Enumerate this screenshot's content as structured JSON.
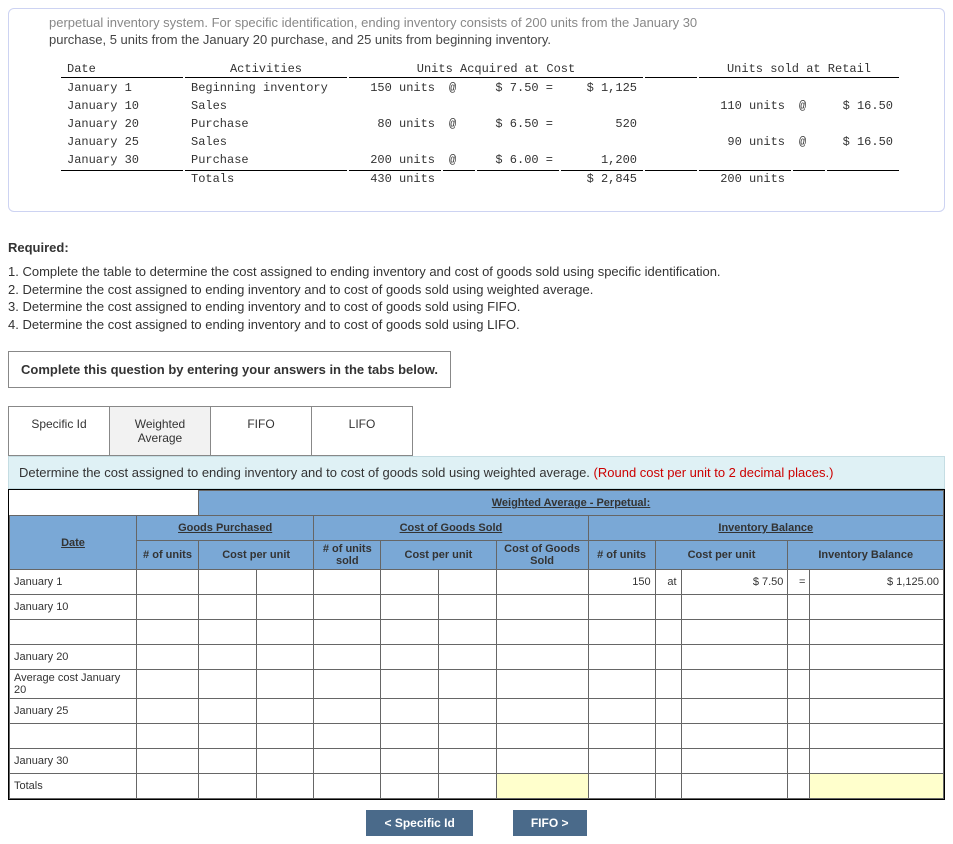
{
  "intro_top": "perpetual inventory system. For specific identification, ending inventory consists of 200 units from the January 30",
  "intro_bot": "purchase, 5 units from the January 20 purchase, and 25 units from beginning inventory.",
  "inv_head": {
    "date": "Date",
    "act": "Activities",
    "acq": "Units Acquired at Cost",
    "sold": "Units sold at Retail"
  },
  "inv": [
    {
      "d": "January 1",
      "a": "Beginning inventory",
      "u": "150 units",
      "at": "@",
      "p": "$ 7.50 =",
      "ext": "$ 1,125",
      "su": "",
      "sat": "",
      "sp": ""
    },
    {
      "d": "January 10",
      "a": "Sales",
      "u": "",
      "at": "",
      "p": "",
      "ext": "",
      "su": "110 units",
      "sat": "@",
      "sp": "$ 16.50"
    },
    {
      "d": "January 20",
      "a": "Purchase",
      "u": "80 units",
      "at": "@",
      "p": "$ 6.50 =",
      "ext": "520",
      "su": "",
      "sat": "",
      "sp": ""
    },
    {
      "d": "January 25",
      "a": "Sales",
      "u": "",
      "at": "",
      "p": "",
      "ext": "",
      "su": "90 units",
      "sat": "@",
      "sp": "$ 16.50"
    },
    {
      "d": "January 30",
      "a": "Purchase",
      "u": "200 units",
      "at": "@",
      "p": "$ 6.00 =",
      "ext": "1,200",
      "su": "",
      "sat": "",
      "sp": ""
    }
  ],
  "inv_tot": {
    "a": "Totals",
    "u": "430 units",
    "ext": "$ 2,845",
    "su": "200 units"
  },
  "required_head": "Required:",
  "required": [
    "1. Complete the table to determine the cost assigned to ending inventory and cost of goods sold using specific identification.",
    "2. Determine the cost assigned to ending inventory and to cost of goods sold using weighted average.",
    "3. Determine the cost assigned to ending inventory and to cost of goods sold using FIFO.",
    "4. Determine the cost assigned to ending inventory and to cost of goods sold using LIFO."
  ],
  "complete": "Complete this question by entering your answers in the tabs below.",
  "tabs": {
    "si": "Specific Id",
    "wa_l1": "Weighted",
    "wa_l2": "Average",
    "fifo": "FIFO",
    "lifo": "LIFO"
  },
  "instr_a": "Determine the cost assigned to ending inventory and to cost of goods sold using weighted average. ",
  "instr_b": "(Round cost per unit to 2 decimal places.)",
  "wa_title": "Weighted Average - Perpetual:",
  "h": {
    "date": "Date",
    "gp": "Goods Purchased",
    "cogs": "Cost of Goods Sold",
    "ib": "Inventory Balance",
    "units": "# of units",
    "cpu": "Cost per unit",
    "sold": "# of units sold",
    "cogs2": "Cost of Goods Sold",
    "inv": "Inventory Balance"
  },
  "rows": [
    "January 1",
    "January 10",
    "",
    "January 20",
    "Average cost January 20",
    "January 25",
    "",
    "January 30",
    "Totals"
  ],
  "r1": {
    "iu": "150",
    "at": "at",
    "dol": "$",
    "cpu": "7.50",
    "eq": "=",
    "dol2": "$",
    "ib": "1,125.00"
  },
  "nav": {
    "prev": "<  Specific Id",
    "next": "FIFO  >"
  }
}
